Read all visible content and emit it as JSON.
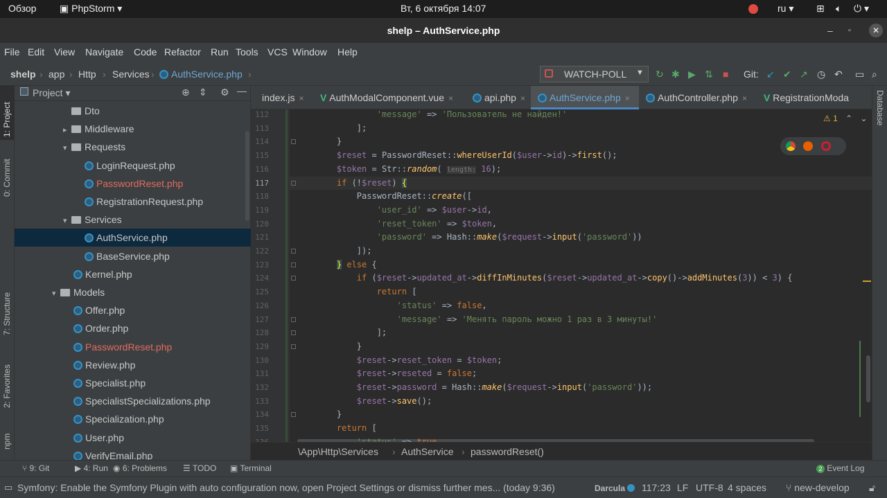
{
  "system": {
    "activities": "Обзор",
    "app": "PhpStorm",
    "datetime": "Вт, 6 октября  14:07",
    "lang": "ru"
  },
  "window": {
    "title": "shelp – AuthService.php"
  },
  "menu": [
    "File",
    "Edit",
    "View",
    "Navigate",
    "Code",
    "Refactor",
    "Run",
    "Tools",
    "VCS",
    "Window",
    "Help"
  ],
  "breadcrumbs": [
    "shelp",
    "app",
    "Http",
    "Services",
    "AuthService.php"
  ],
  "run_config": "WATCH-POLL",
  "git_label": "Git:",
  "left_stripe": [
    "1: Project",
    "0: Commit",
    "7: Structure",
    "2: Favorites",
    "npm"
  ],
  "right_stripe": "Database",
  "project": {
    "title": "Project",
    "items": [
      {
        "label": "Dto",
        "kind": "folder",
        "depth": 1,
        "arrow": ""
      },
      {
        "label": "Middleware",
        "kind": "folder",
        "depth": 1,
        "arrow": "▸"
      },
      {
        "label": "Requests",
        "kind": "folder",
        "depth": 1,
        "arrow": "▾"
      },
      {
        "label": "LoginRequest.php",
        "kind": "php",
        "depth": 2
      },
      {
        "label": "PasswordReset.php",
        "kind": "php",
        "depth": 2,
        "error": true
      },
      {
        "label": "RegistrationRequest.php",
        "kind": "php",
        "depth": 2
      },
      {
        "label": "Services",
        "kind": "folder",
        "depth": 1,
        "arrow": "▾"
      },
      {
        "label": "AuthService.php",
        "kind": "php",
        "depth": 2,
        "selected": true
      },
      {
        "label": "BaseService.php",
        "kind": "php",
        "depth": 2
      },
      {
        "label": "Kernel.php",
        "kind": "php",
        "depth": 1
      },
      {
        "label": "Models",
        "kind": "folder",
        "depth": 0,
        "arrow": "▾"
      },
      {
        "label": "Offer.php",
        "kind": "php",
        "depth": 1
      },
      {
        "label": "Order.php",
        "kind": "php",
        "depth": 1
      },
      {
        "label": "PasswordReset.php",
        "kind": "php",
        "depth": 1,
        "error": true
      },
      {
        "label": "Review.php",
        "kind": "php",
        "depth": 1
      },
      {
        "label": "Specialist.php",
        "kind": "php",
        "depth": 1
      },
      {
        "label": "SpecialistSpecializations.php",
        "kind": "php",
        "depth": 1
      },
      {
        "label": "Specialization.php",
        "kind": "php",
        "depth": 1
      },
      {
        "label": "User.php",
        "kind": "php",
        "depth": 1
      },
      {
        "label": "VerifyEmail.php",
        "kind": "php",
        "depth": 1
      }
    ]
  },
  "tabs": [
    {
      "label": "index.js",
      "icon": "js"
    },
    {
      "label": "AuthModalComponent.vue",
      "icon": "vue"
    },
    {
      "label": "api.php",
      "icon": "php"
    },
    {
      "label": "AuthService.php",
      "icon": "php",
      "active": true
    },
    {
      "label": "AuthController.php",
      "icon": "php"
    },
    {
      "label": "RegistrationModa",
      "icon": "vue"
    }
  ],
  "inspection": "⚠ 1",
  "editor": {
    "lines": [
      {
        "n": "112",
        "html": "            <span class=\"s\">'message'</span> => <span class=\"s\">'Пользователь не найден!'</span>"
      },
      {
        "n": "113",
        "html": "        ];"
      },
      {
        "n": "114",
        "html": "    }"
      },
      {
        "n": "115",
        "html": "    <span class=\"v\">$reset</span> = PasswordReset::<span class=\"f\">whereUserId</span>(<span class=\"v\">$user</span>-><span class=\"v\">id</span>)-><span class=\"f\">first</span>();"
      },
      {
        "n": "116",
        "html": "    <span class=\"v\">$token</span> = Str::<span class=\"f i\">random</span>( <span style=\"color:#787878;background:#3b3b3b;font-size:10px\">length:</span> <span class=\"v\">16</span>);"
      },
      {
        "n": "117",
        "html": "    <span class=\"k\">if</span> (!<span class=\"v\">$reset</span>) <span style=\"background:#3b514d;color:#ffef28\">{</span>",
        "current": true
      },
      {
        "n": "118",
        "html": "        PasswordReset::<span class=\"f i\">create</span>(["
      },
      {
        "n": "119",
        "html": "            <span class=\"s\">'user_id'</span> => <span class=\"v\">$user</span>-><span class=\"v\">id</span>,"
      },
      {
        "n": "120",
        "html": "            <span class=\"s\">'reset_token'</span> => <span class=\"v\">$token</span>,"
      },
      {
        "n": "121",
        "html": "            <span class=\"s\">'password'</span> => Hash::<span class=\"f i\">make</span>(<span class=\"v\">$request</span>-><span class=\"f\">input</span>(<span class=\"s\">'password'</span>))"
      },
      {
        "n": "122",
        "html": "        ]);"
      },
      {
        "n": "123",
        "html": "    <span style=\"background:#3b514d;color:#ffef28\">}</span> <span class=\"k\">else</span> {"
      },
      {
        "n": "124",
        "html": "        <span class=\"k\">if</span> (<span class=\"v\">$reset</span>-><span class=\"v\">updated_at</span>-><span class=\"f\">diffInMinutes</span>(<span class=\"v\">$reset</span>-><span class=\"v\">updated_at</span>-><span class=\"f\">copy</span>()-><span class=\"f\">addMinutes</span>(<span class=\"v\">3</span>)) < <span class=\"v\">3</span>) {"
      },
      {
        "n": "125",
        "html": "            <span class=\"k\">return</span> ["
      },
      {
        "n": "126",
        "html": "                <span class=\"s\">'status'</span> => <span class=\"k\">false</span>,"
      },
      {
        "n": "127",
        "html": "                <span class=\"s\">'message'</span> => <span class=\"s\">'Менять пароль можно 1 раз в 3 минуты!'</span>"
      },
      {
        "n": "128",
        "html": "            ];"
      },
      {
        "n": "129",
        "html": "        }"
      },
      {
        "n": "130",
        "html": "        <span class=\"v\">$reset</span>-><span class=\"v\">reset_token</span> = <span class=\"v\">$token</span>;"
      },
      {
        "n": "131",
        "html": "        <span class=\"v\">$reset</span>-><span class=\"v\">reseted</span> = <span class=\"k\">false</span>;"
      },
      {
        "n": "132",
        "html": "        <span class=\"v\">$reset</span>-><span class=\"v\">password</span> = Hash::<span class=\"f i\">make</span>(<span class=\"v\">$request</span>-><span class=\"f\">input</span>(<span class=\"s\">'password'</span>));"
      },
      {
        "n": "133",
        "html": "        <span class=\"v\">$reset</span>-><span class=\"f\">save</span>();"
      },
      {
        "n": "134",
        "html": "    }"
      },
      {
        "n": "135",
        "html": "    <span class=\"k\">return</span> ["
      },
      {
        "n": "136",
        "html": "        <span class=\"s\">'status'</span> => <span class=\"k\">true</span>,"
      }
    ]
  },
  "code_path": [
    "\\App\\Http\\Services",
    "AuthService",
    "passwordReset()"
  ],
  "bottom_tools": [
    {
      "label": "9: Git"
    },
    {
      "label": "4: Run"
    },
    {
      "label": "6: Problems"
    },
    {
      "label": "TODO"
    },
    {
      "label": "Terminal"
    }
  ],
  "event_log": "Event Log",
  "event_log_count": "2",
  "status": {
    "message": "Symfony: Enable the Symfony Plugin with auto configuration now, open Project Settings or dismiss further mes... (today 9:36)",
    "theme": "Darcula",
    "position": "117:23",
    "line_sep": "LF",
    "encoding": "UTF-8",
    "indent": "4 spaces",
    "branch": "new-develop"
  }
}
